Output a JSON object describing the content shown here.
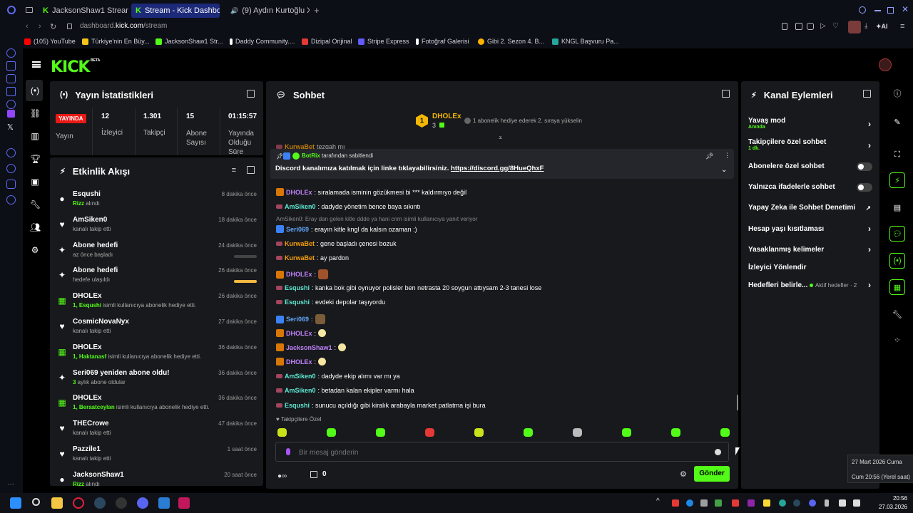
{
  "browser": {
    "tabs": [
      {
        "label": "JacksonShaw1 Stream - W"
      },
      {
        "label": "Stream - Kick Dashboard"
      },
      {
        "label": "(9) Aydın Kurtoğlu X U..."
      }
    ],
    "url_prefix": "dashboard.",
    "url_domain": "kick.com",
    "url_path": "/stream",
    "ai_label": "AI",
    "bookmarks": [
      {
        "label": "(105) YouTube",
        "color": "#ff0000"
      },
      {
        "label": "Türkiye'nin En Büy...",
        "color": "#f5c518"
      },
      {
        "label": "JacksonShaw1 Str...",
        "color": "#53fc18"
      },
      {
        "label": "Daddy Community....",
        "color": "#ffffff"
      },
      {
        "label": "Dizipal Orijinal",
        "color": "#e53935"
      },
      {
        "label": "Stripe Express",
        "color": "#635bff"
      },
      {
        "label": "Fotoğraf Galerisi",
        "color": "#ffffff"
      },
      {
        "label": "Gibi 2. Sezon 4. B...",
        "color": "#ffb300"
      },
      {
        "label": "KNGL Başvuru Pa...",
        "color": "#26a69a"
      }
    ]
  },
  "kick": {
    "logo": "KICK",
    "beta": "BETA"
  },
  "stats": {
    "title": "Yayın İstatistikleri",
    "live_badge": "YAYINDA",
    "live_label": "Yayın",
    "items": [
      {
        "value": "12",
        "label": "İzleyici"
      },
      {
        "value": "1.301",
        "label": "Takipçi"
      },
      {
        "value": "15",
        "label": "Abone Sayısı"
      },
      {
        "value": "01:15:57",
        "label": "Yayında Olduğu Süre"
      }
    ]
  },
  "feed": {
    "title": "Etkinlik Akışı",
    "items": [
      {
        "title": "Esqushi",
        "sub_bold": "Rizz",
        "sub": " alındı",
        "time": "8 dakika önce",
        "icon": "gift-icon"
      },
      {
        "title": "AmSiken0",
        "sub_bold": "",
        "sub": "kanalı takip etti",
        "time": "18 dakika önce",
        "icon": "heart-icon"
      },
      {
        "title": "Abone hedefi",
        "sub_bold": "",
        "sub": "az önce başladı",
        "time": "24 dakika önce",
        "icon": "sparkle-icon",
        "progress": 0
      },
      {
        "title": "Abone hedefi",
        "sub_bold": "",
        "sub": "hedefe ulaşıldı",
        "time": "26 dakika önce",
        "icon": "sparkle-icon",
        "progress": 1
      },
      {
        "title": "DHOLEx",
        "sub_bold": "1, Esqushi",
        "sub": " isimli kullanıcıya abonelik hediye etti.",
        "time": "26 dakika önce",
        "icon": "gift-box-icon"
      },
      {
        "title": "CosmicNovaNyx",
        "sub_bold": "",
        "sub": "kanalı takip etti",
        "time": "27 dakika önce",
        "icon": "heart-icon"
      },
      {
        "title": "DHOLEx",
        "sub_bold": "1, Haktanasf",
        "sub": " isimli kullanıcıya abonelik hediye etti.",
        "time": "36 dakika önce",
        "icon": "gift-box-icon"
      },
      {
        "title": "Seri069 yeniden abone oldu!",
        "sub_bold": "3",
        "sub": " aylık abone oldular",
        "time": "36 dakika önce",
        "icon": "sparkle-icon"
      },
      {
        "title": "DHOLEx",
        "sub_bold": "1, Beraatceylan",
        "sub": " isimli kullanıcıya abonelik hediye etti.",
        "time": "36 dakika önce",
        "icon": "gift-box-icon"
      },
      {
        "title": "THECrowe",
        "sub_bold": "",
        "sub": "kanalı takip etti",
        "time": "47 dakika önce",
        "icon": "heart-icon"
      },
      {
        "title": "Pazzile1",
        "sub_bold": "",
        "sub": "kanalı takip etti",
        "time": "1 saat önce",
        "icon": "heart-icon"
      },
      {
        "title": "JacksonShaw1",
        "sub_bold": "Rizz",
        "sub": " alındı",
        "time": "20 saat önce",
        "icon": "gift-icon"
      }
    ]
  },
  "chat": {
    "title": "Sohbet",
    "top_gifter": {
      "name": "DHOLEx",
      "count": "3",
      "text": "1 abonelik hediye ederek 2. sıraya yükselin"
    },
    "partial_line": {
      "user": "KurwaBet",
      "text": "tezgah mı"
    },
    "pinned": {
      "by": "BotRix",
      "by_suffix": "tarafından sabitlendi",
      "text": "Discord kanalımıza katılmak için linke tıklayabilirsiniz. ",
      "link": "https://discord.gg/8HueQhxF"
    },
    "messages": [
      {
        "user": "DHOLEx",
        "color": "#c084fc",
        "text": ": sıralamada isminin gözükmesi bi *** kaldırmıyo değil"
      },
      {
        "user": "AmSiken0",
        "color": "#5eead4",
        "text": ": dadyde yönetim bence baya sıkıntı"
      },
      {
        "reply": "AmSiken0: Eray dan gelen kitle ddde ya hani cnm isimli kullanıcıya yanıt veriyor"
      },
      {
        "user": "Seri069",
        "color": "#60a5fa",
        "text": ": erayın kitle kngl da kalsın ozaman :)"
      },
      {
        "user": "KurwaBet",
        "color": "#f59e0b",
        "text": ": gene başladı çenesi bozuk"
      },
      {
        "user": "KurwaBet",
        "color": "#f59e0b",
        "text": ": ay pardon"
      },
      {
        "user": "DHOLEx",
        "color": "#c084fc",
        "text": ":"
      },
      {
        "user": "Esqushi",
        "color": "#5eead4",
        "text": ": kanka bok gibi oynuyor polisler ben netrasta 20 soygun attıysam 2-3 tanesi lose"
      },
      {
        "user": "Esqushi",
        "color": "#5eead4",
        "text": ": evdeki depolar taşıyordu"
      },
      {
        "user": "Seri069",
        "color": "#60a5fa",
        "text": ":"
      },
      {
        "user": "DHOLEx",
        "color": "#c084fc",
        "text": ":"
      },
      {
        "user": "JacksonShaw1",
        "color": "#c084fc",
        "text": ":"
      },
      {
        "user": "DHOLEx",
        "color": "#c084fc",
        "text": ":"
      },
      {
        "user": "AmSiken0",
        "color": "#5eead4",
        "text": ": dadyde ekip alımı var mı ya"
      },
      {
        "user": "AmSiken0",
        "color": "#5eead4",
        "text": ": betadan kalan ekipler varmı hala"
      },
      {
        "user": "Esqushi",
        "color": "#5eead4",
        "text": ": sunucu açıldığı gibi kiralık arabayla market patlatma işi bura"
      }
    ],
    "followers_only": "Takipçilere Özel",
    "input_placeholder": "Bir mesaj gönderin",
    "points": "0",
    "send": "Gönder"
  },
  "channel": {
    "title": "Kanal Eylemleri",
    "slow_mode": {
      "label": "Yavaş mod",
      "sub": "Anında"
    },
    "followers_only": {
      "label": "Takipçilere özel sohbet",
      "sub": "1 dk."
    },
    "subs_only": "Abonelere özel sohbet",
    "emotes_only": "Yalnızca ifadelerle sohbet",
    "ai_moderation": "Yapay Zeka ile Sohbet Denetimi",
    "age_restriction": "Hesap yaşı kısıtlaması",
    "banned_words": "Yasaklanmış kelimeler",
    "viewer_redirect": "İzleyici Yönlendir",
    "goals": "Hedefleri belirle...",
    "goals_active": "Aktif hedefler · 2"
  },
  "tooltip": {
    "date": "27 Mart 2026 Cuma",
    "time": "Cum 20:56 (Yerel saat)"
  },
  "taskbar": {
    "time": "20:56",
    "date": "27.03.2026"
  },
  "colors": {
    "kick_green": "#53fc18",
    "live_red": "#e91916",
    "panel": "#18191c"
  }
}
